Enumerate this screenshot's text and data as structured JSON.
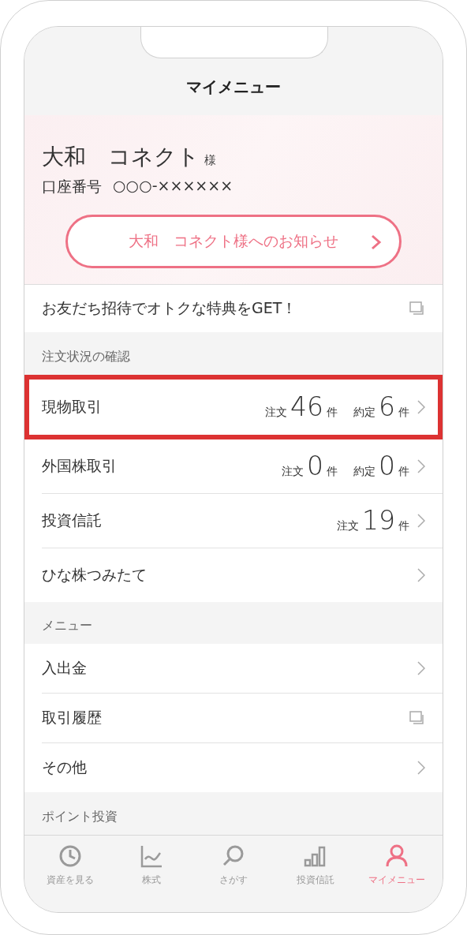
{
  "header": {
    "title": "マイメニュー"
  },
  "profile": {
    "name": "大和　コネクト",
    "honorific": "様",
    "account_label": "口座番号",
    "account_number": "○○○-××××××",
    "notice_button": "大和　コネクト様へのお知らせ"
  },
  "invite": {
    "label": "お友だち招待でオトクな特典をGET！",
    "kind": "external"
  },
  "sections": [
    {
      "title": "注文状況の確認",
      "rows": [
        {
          "label": "現物取引",
          "highlighted": true,
          "kind": "link",
          "counts": [
            {
              "label": "注文",
              "number": "46",
              "unit": "件"
            },
            {
              "label": "約定",
              "number": "6",
              "unit": "件"
            }
          ]
        },
        {
          "label": "外国株取引",
          "highlighted": false,
          "kind": "link",
          "counts": [
            {
              "label": "注文",
              "number": "0",
              "unit": "件"
            },
            {
              "label": "約定",
              "number": "0",
              "unit": "件"
            }
          ]
        },
        {
          "label": "投資信託",
          "highlighted": false,
          "kind": "link",
          "counts": [
            {
              "label": "注文",
              "number": "19",
              "unit": "件"
            }
          ]
        },
        {
          "label": "ひな株つみたて",
          "highlighted": false,
          "kind": "link"
        }
      ]
    },
    {
      "title": "メニュー",
      "rows": [
        {
          "label": "入出金",
          "highlighted": false,
          "kind": "link"
        },
        {
          "label": "取引履歴",
          "highlighted": false,
          "kind": "external"
        },
        {
          "label": "その他",
          "highlighted": false,
          "kind": "link"
        }
      ]
    },
    {
      "title": "ポイント投資"
    }
  ],
  "tab_bar": [
    {
      "label": "資産を見る",
      "selected": false
    },
    {
      "label": "株式",
      "selected": false
    },
    {
      "label": "さがす",
      "selected": false
    },
    {
      "label": "投資信託",
      "selected": false
    },
    {
      "label": "マイメニュー",
      "selected": true
    }
  ]
}
